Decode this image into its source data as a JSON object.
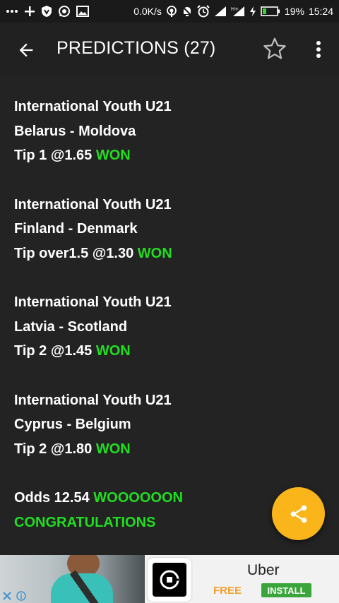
{
  "status_bar": {
    "network_speed": "0.0K/s",
    "battery_percent": "19%",
    "time": "15:24",
    "left_icons": [
      "more-notifications-icon",
      "plus-icon",
      "vpn-shield-icon",
      "whatsapp-icon",
      "image-icon"
    ],
    "right_icons": [
      "hotspot-icon",
      "mute-notification-icon",
      "alarm-clock-icon",
      "signal-icon",
      "hplus-signal-icon",
      "charging-icon",
      "battery-icon"
    ]
  },
  "toolbar": {
    "title": "PREDICTIONS (27)",
    "back_icon": "arrow-left-icon",
    "favorite_icon": "star-outline-icon",
    "menu_icon": "more-vertical-icon"
  },
  "predictions": [
    {
      "league": "International Youth U21",
      "match": "Belarus - Moldova",
      "tip": "Tip 1 @1.65",
      "result": "WON"
    },
    {
      "league": "International Youth U21",
      "match": "Finland - Denmark",
      "tip": "Tip over1.5 @1.30",
      "result": "WON"
    },
    {
      "league": "International Youth U21",
      "match": "Latvia - Scotland",
      "tip": "Tip 2 @1.45",
      "result": "WON"
    },
    {
      "league": "International Youth U21",
      "match": "Cyprus - Belgium",
      "tip": "Tip 2 @1.80",
      "result": "WON"
    }
  ],
  "summary": {
    "odds_label": "Odds 12.54",
    "odds_result": "WOOOOOON",
    "congrats": "CONGRATULATIONS"
  },
  "fab": {
    "icon": "share-icon",
    "color": "#f9b51a"
  },
  "ad": {
    "app_name": "Uber",
    "price": "FREE",
    "install_label": "INSTALL",
    "close_icon": "close-icon",
    "info_icon": "info-icon"
  },
  "colors": {
    "background": "#232323",
    "accent_green": "#22dd22",
    "fab": "#f9b51a",
    "install": "#3aa53a"
  }
}
